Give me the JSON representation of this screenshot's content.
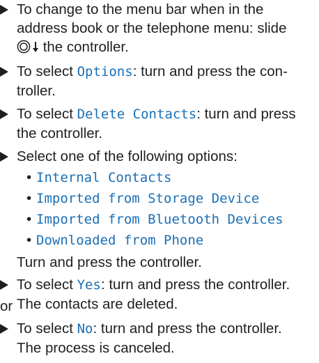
{
  "steps": [
    {
      "line1": "To change to the menu bar when in the",
      "line2": "address book or the telephone menu: slide",
      "line3": "the controller."
    },
    {
      "prefix": "To select ",
      "term": "Options",
      "suffix1": ": turn and press the con-",
      "line2": "troller."
    },
    {
      "prefix": "To select ",
      "term": "Delete Contacts",
      "suffix1": ": turn and press",
      "line2": "the controller."
    },
    {
      "line1": "Select one of the following options:",
      "options": [
        "Internal Contacts",
        "Imported from Storage Device",
        "Imported from Bluetooth Devices",
        "Downloaded from Phone"
      ],
      "after": "Turn and press the controller."
    },
    {
      "prefix": "To select ",
      "term": "Yes",
      "suffix1": ": turn and press the controller.",
      "line2": "The contacts are deleted."
    },
    {
      "prefix": "To select ",
      "term": "No",
      "suffix1": ": turn and press the controller.",
      "line2": "The process is canceled."
    }
  ],
  "or_label": "or",
  "colors": {
    "text": "#1f1f1f",
    "term": "#1a6fb5"
  },
  "icons": {
    "controller": "controller-dial-icon",
    "slide": "slide-down-arrow-icon",
    "step": "triangle-arrow-icon",
    "bullet": "bullet-dot"
  }
}
